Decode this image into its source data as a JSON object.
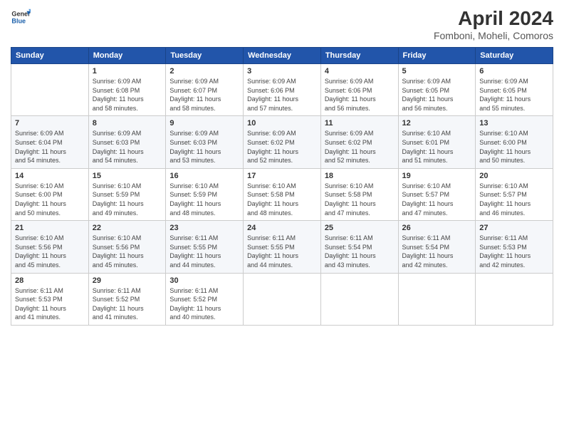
{
  "header": {
    "logo_line1": "General",
    "logo_line2": "Blue",
    "title": "April 2024",
    "subtitle": "Fomboni, Moheli, Comoros"
  },
  "calendar": {
    "weekdays": [
      "Sunday",
      "Monday",
      "Tuesday",
      "Wednesday",
      "Thursday",
      "Friday",
      "Saturday"
    ],
    "rows": [
      [
        {
          "day": "",
          "info": ""
        },
        {
          "day": "1",
          "info": "Sunrise: 6:09 AM\nSunset: 6:08 PM\nDaylight: 11 hours\nand 58 minutes."
        },
        {
          "day": "2",
          "info": "Sunrise: 6:09 AM\nSunset: 6:07 PM\nDaylight: 11 hours\nand 58 minutes."
        },
        {
          "day": "3",
          "info": "Sunrise: 6:09 AM\nSunset: 6:06 PM\nDaylight: 11 hours\nand 57 minutes."
        },
        {
          "day": "4",
          "info": "Sunrise: 6:09 AM\nSunset: 6:06 PM\nDaylight: 11 hours\nand 56 minutes."
        },
        {
          "day": "5",
          "info": "Sunrise: 6:09 AM\nSunset: 6:05 PM\nDaylight: 11 hours\nand 56 minutes."
        },
        {
          "day": "6",
          "info": "Sunrise: 6:09 AM\nSunset: 6:05 PM\nDaylight: 11 hours\nand 55 minutes."
        }
      ],
      [
        {
          "day": "7",
          "info": "Sunrise: 6:09 AM\nSunset: 6:04 PM\nDaylight: 11 hours\nand 54 minutes."
        },
        {
          "day": "8",
          "info": "Sunrise: 6:09 AM\nSunset: 6:03 PM\nDaylight: 11 hours\nand 54 minutes."
        },
        {
          "day": "9",
          "info": "Sunrise: 6:09 AM\nSunset: 6:03 PM\nDaylight: 11 hours\nand 53 minutes."
        },
        {
          "day": "10",
          "info": "Sunrise: 6:09 AM\nSunset: 6:02 PM\nDaylight: 11 hours\nand 52 minutes."
        },
        {
          "day": "11",
          "info": "Sunrise: 6:09 AM\nSunset: 6:02 PM\nDaylight: 11 hours\nand 52 minutes."
        },
        {
          "day": "12",
          "info": "Sunrise: 6:10 AM\nSunset: 6:01 PM\nDaylight: 11 hours\nand 51 minutes."
        },
        {
          "day": "13",
          "info": "Sunrise: 6:10 AM\nSunset: 6:00 PM\nDaylight: 11 hours\nand 50 minutes."
        }
      ],
      [
        {
          "day": "14",
          "info": "Sunrise: 6:10 AM\nSunset: 6:00 PM\nDaylight: 11 hours\nand 50 minutes."
        },
        {
          "day": "15",
          "info": "Sunrise: 6:10 AM\nSunset: 5:59 PM\nDaylight: 11 hours\nand 49 minutes."
        },
        {
          "day": "16",
          "info": "Sunrise: 6:10 AM\nSunset: 5:59 PM\nDaylight: 11 hours\nand 48 minutes."
        },
        {
          "day": "17",
          "info": "Sunrise: 6:10 AM\nSunset: 5:58 PM\nDaylight: 11 hours\nand 48 minutes."
        },
        {
          "day": "18",
          "info": "Sunrise: 6:10 AM\nSunset: 5:58 PM\nDaylight: 11 hours\nand 47 minutes."
        },
        {
          "day": "19",
          "info": "Sunrise: 6:10 AM\nSunset: 5:57 PM\nDaylight: 11 hours\nand 47 minutes."
        },
        {
          "day": "20",
          "info": "Sunrise: 6:10 AM\nSunset: 5:57 PM\nDaylight: 11 hours\nand 46 minutes."
        }
      ],
      [
        {
          "day": "21",
          "info": "Sunrise: 6:10 AM\nSunset: 5:56 PM\nDaylight: 11 hours\nand 45 minutes."
        },
        {
          "day": "22",
          "info": "Sunrise: 6:10 AM\nSunset: 5:56 PM\nDaylight: 11 hours\nand 45 minutes."
        },
        {
          "day": "23",
          "info": "Sunrise: 6:11 AM\nSunset: 5:55 PM\nDaylight: 11 hours\nand 44 minutes."
        },
        {
          "day": "24",
          "info": "Sunrise: 6:11 AM\nSunset: 5:55 PM\nDaylight: 11 hours\nand 44 minutes."
        },
        {
          "day": "25",
          "info": "Sunrise: 6:11 AM\nSunset: 5:54 PM\nDaylight: 11 hours\nand 43 minutes."
        },
        {
          "day": "26",
          "info": "Sunrise: 6:11 AM\nSunset: 5:54 PM\nDaylight: 11 hours\nand 42 minutes."
        },
        {
          "day": "27",
          "info": "Sunrise: 6:11 AM\nSunset: 5:53 PM\nDaylight: 11 hours\nand 42 minutes."
        }
      ],
      [
        {
          "day": "28",
          "info": "Sunrise: 6:11 AM\nSunset: 5:53 PM\nDaylight: 11 hours\nand 41 minutes."
        },
        {
          "day": "29",
          "info": "Sunrise: 6:11 AM\nSunset: 5:52 PM\nDaylight: 11 hours\nand 41 minutes."
        },
        {
          "day": "30",
          "info": "Sunrise: 6:11 AM\nSunset: 5:52 PM\nDaylight: 11 hours\nand 40 minutes."
        },
        {
          "day": "",
          "info": ""
        },
        {
          "day": "",
          "info": ""
        },
        {
          "day": "",
          "info": ""
        },
        {
          "day": "",
          "info": ""
        }
      ]
    ]
  }
}
